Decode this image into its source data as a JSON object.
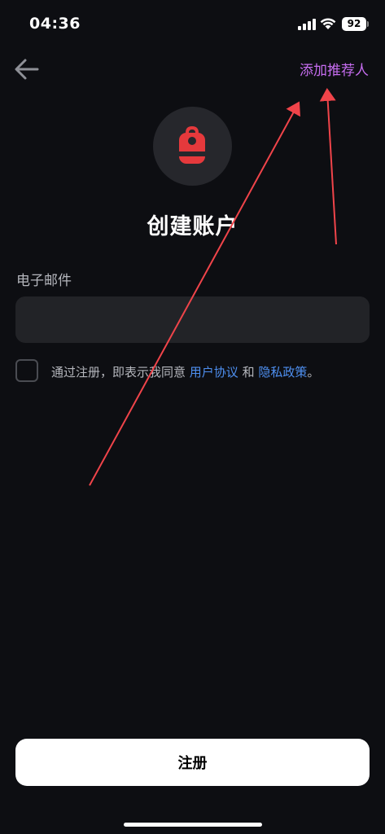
{
  "status_bar": {
    "time": "04:36",
    "battery": "92"
  },
  "header": {
    "add_referrer_label": "添加推荐人"
  },
  "page": {
    "title": "创建账户",
    "email_label": "电子邮件",
    "email_value": "",
    "agreement": {
      "prefix": "通过注册，即表示我同意 ",
      "user_agreement_link": "用户协议",
      "connector": " 和 ",
      "privacy_policy_link": "隐私政策",
      "suffix": "。"
    },
    "register_button": "注册"
  },
  "colors": {
    "background": "#0d0e12",
    "accent_purple": "#c66df0",
    "link_blue": "#4e8ff0",
    "logo_red": "#e5393c",
    "annotation_arrow": "#f0444a"
  },
  "icons": {
    "back": "arrow-left-icon",
    "logo": "backpack-icon",
    "signal": "signal-icon",
    "wifi": "wifi-icon"
  }
}
